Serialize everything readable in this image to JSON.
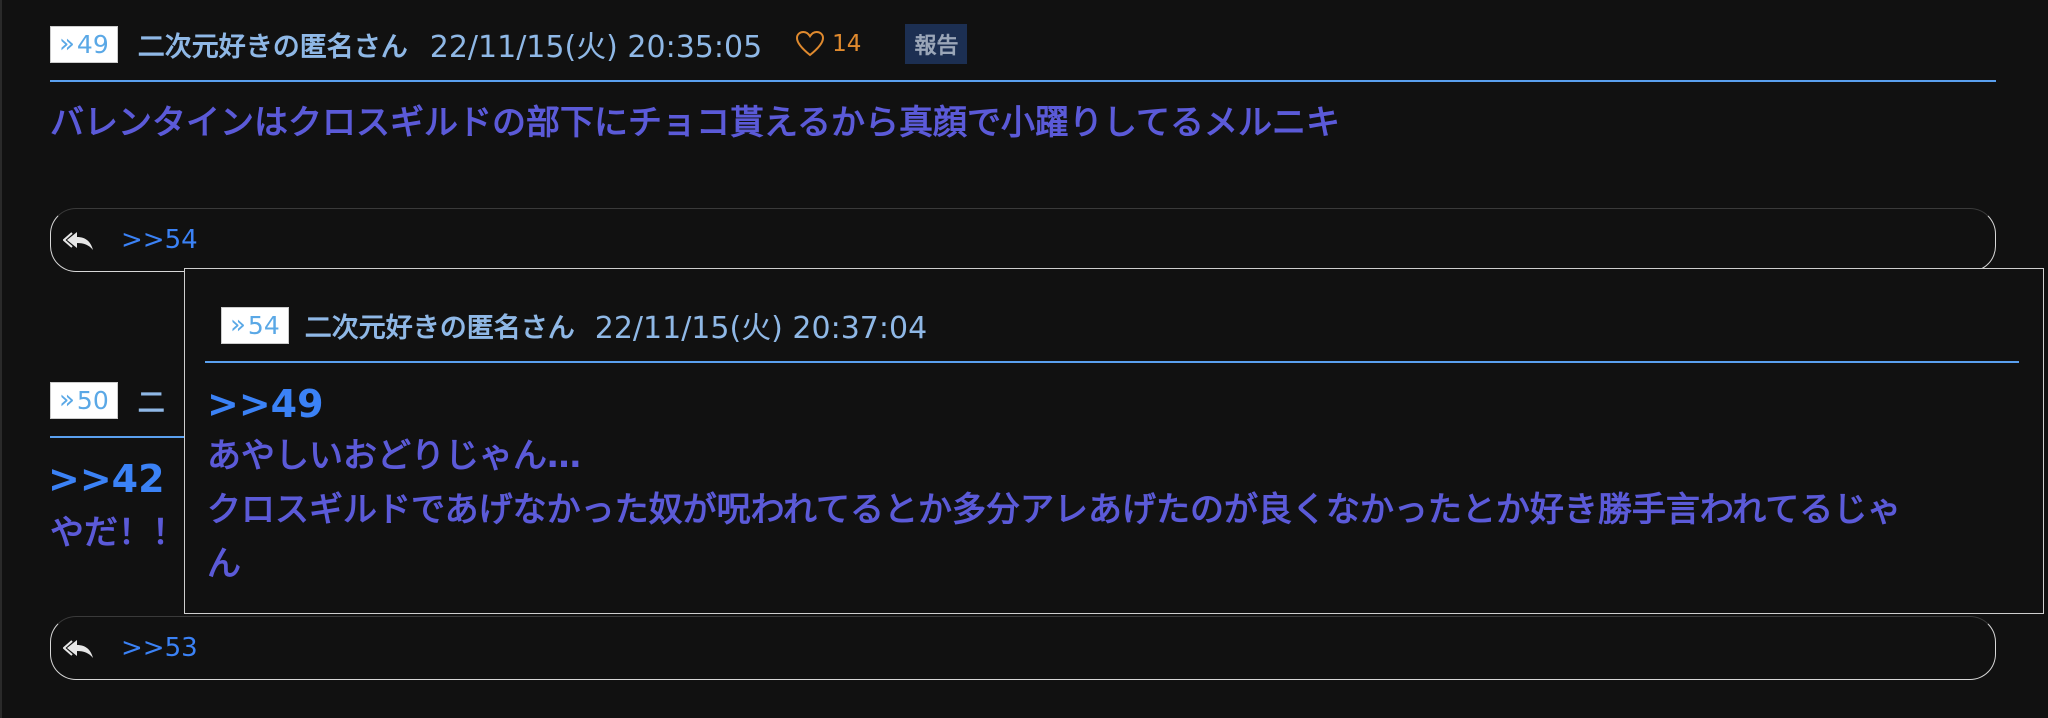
{
  "post49": {
    "number_label": "49",
    "author": "二次元好きの匿名さん",
    "date": "22/11/15(火) 20:35:05",
    "likes": "14",
    "report_label": "報告",
    "body": "バレンタインはクロスギルドの部下にチョコ貰えるから真顔で小躍りしてるメルニキ",
    "reply_link": ">>54"
  },
  "post50": {
    "number_label": "50",
    "author_partial": "二",
    "anchor": ">>42",
    "body_partial": "やだ！！",
    "reply_link": ">>53"
  },
  "popup54": {
    "number_label": "54",
    "author": "二次元好きの匿名さん",
    "date": "22/11/15(火) 20:37:04",
    "anchor": ">>49",
    "line1": "あやしいおどりじゃん…",
    "line2": "クロスギルドであげなかった奴が呪われてるとか多分アレあげたのが良くなかったとか好き勝手言われてるじゃ",
    "line3": "ん"
  },
  "colors": {
    "background": "#111111",
    "header_blue": "#8fb8e6",
    "body_purple": "#5b5ad8",
    "anchor_blue": "#3b82f6",
    "rule_blue": "#5aa0ef",
    "like_orange": "#e08a2e"
  },
  "icons": {
    "number_badge": "double-chevron-icon",
    "like": "heart-icon",
    "reply": "reply-all-icon"
  }
}
